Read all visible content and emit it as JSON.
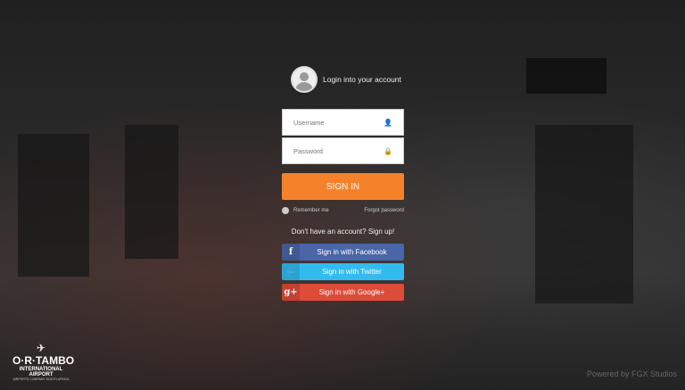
{
  "header": {
    "title": "Login into your account"
  },
  "form": {
    "username_placeholder": "Username",
    "password_placeholder": "Password",
    "signin_label": "SIGN IN",
    "remember_label": "Remember me",
    "forgot_label": "Forgot password",
    "signup_text": "Don't have an account? Sign up!"
  },
  "social": [
    {
      "label": "Sign in with Facebook",
      "icon": "f",
      "color": "#4a66a8"
    },
    {
      "label": "Sign in with Twitter",
      "icon": "🐦",
      "color": "#33bbef"
    },
    {
      "label": "Sign in with Google+",
      "icon": "g+",
      "color": "#dd4b39"
    }
  ],
  "logo": {
    "main": "O·R·TAMBO",
    "sub": "INTERNATIONAL AIRPORT",
    "tag": "AIRPORTS COMPANY SOUTH AFRICA"
  },
  "footer": {
    "powered": "Powered by FGX Studios"
  },
  "colors": {
    "accent": "#f5822a"
  }
}
